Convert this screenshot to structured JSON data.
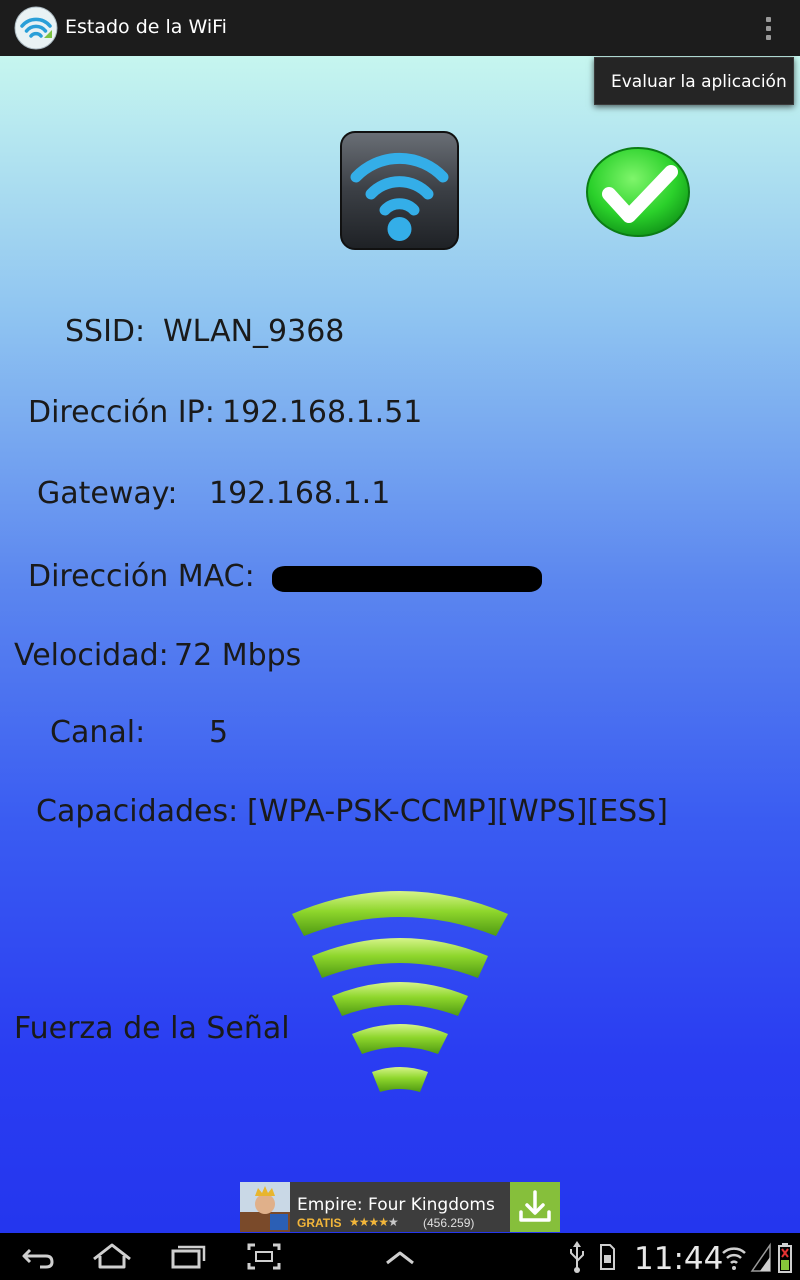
{
  "app_bar": {
    "title": "Estado de la WiFi",
    "menu_icon": "overflow-menu-icon"
  },
  "menu": {
    "items": [
      "Evaluar la aplicación"
    ]
  },
  "status": {
    "wifi_icon": "wifi-icon",
    "connected_icon": "check-icon"
  },
  "info": {
    "ssid_label": "SSID:",
    "ssid_value": "WLAN_9368",
    "ip_label": "Dirección IP:",
    "ip_value": "192.168.1.51",
    "gateway_label": "Gateway:",
    "gateway_value": "192.168.1.1",
    "mac_label": "Dirección MAC:",
    "speed_label": "Velocidad:",
    "speed_value": "72 Mbps",
    "channel_label": "Canal:",
    "channel_value": "5",
    "capabilities_label": "Capacidades:",
    "capabilities_value": "[WPA-PSK-CCMP][WPS][ESS]",
    "signal_label": "Fuerza de la Señal",
    "signal_bars": 5
  },
  "ad": {
    "title": "Empire: Four Kingdoms",
    "price": "GRATIS",
    "rating_stars": 4,
    "rating_count": "(456.259)",
    "download_icon": "download-icon"
  },
  "system_bar": {
    "time": "11:44",
    "nav_icons": [
      "back-icon",
      "home-icon",
      "recent-apps-icon",
      "screenshot-icon",
      "up-chevron-icon"
    ],
    "status_icons": [
      "usb-icon",
      "sd-card-icon",
      "wifi-signal-icon",
      "cell-signal-icon",
      "battery-icon"
    ]
  },
  "colors": {
    "action_bar": "#1c1c1c",
    "gradient_top": "#c6f6ef",
    "gradient_bottom": "#2436ee",
    "signal_green": "#8ed62c",
    "ad_button": "#86bf3b"
  }
}
